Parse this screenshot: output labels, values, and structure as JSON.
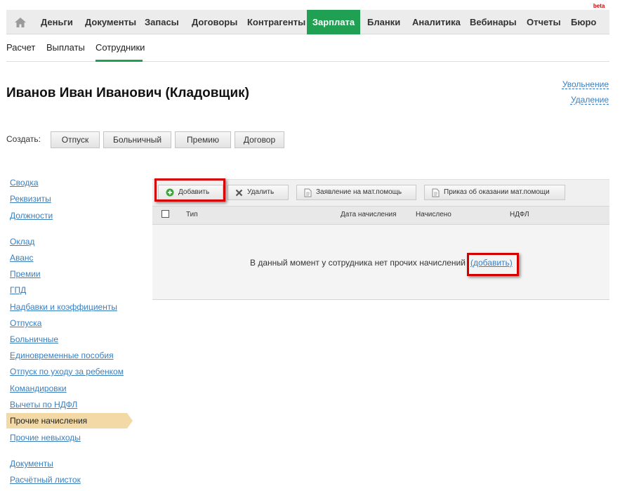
{
  "topnav": {
    "items": [
      "Деньги",
      "Документы",
      "Запасы",
      "Договоры",
      "Контрагенты",
      "Зарплата",
      "Бланки",
      "Аналитика",
      "Вебинары",
      "Отчеты",
      "Бюро"
    ],
    "beta": "beta",
    "active_color": "#20a052"
  },
  "subnav": {
    "items": [
      "Расчет",
      "Выплаты",
      "Сотрудники"
    ]
  },
  "header": {
    "title": "Иванов Иван Иванович (Кладовщик)",
    "dismiss_link": "Увольнение",
    "delete_link": "Удаление"
  },
  "create": {
    "label": "Создать:",
    "buttons": [
      "Отпуск",
      "Больничный",
      "Премию",
      "Договор"
    ]
  },
  "leftmenu": {
    "group1": [
      "Сводка",
      "Реквизиты",
      "Должности"
    ],
    "group2": [
      "Оклад",
      "Аванс",
      "Премии",
      "ГПД",
      "Надбавки и коэффициенты",
      "Отпуска",
      "Больничные",
      "Единовременные пособия",
      "Отпуск по уходу за ребенком",
      "Командировки",
      "Вычеты по НДФЛ",
      "Прочие начисления",
      "Прочие невыходы"
    ],
    "group3": [
      "Документы",
      "Расчётный листок"
    ],
    "active_color": "#f3d9a6"
  },
  "toolbar": {
    "add": "Добавить",
    "delete": "Удалить",
    "statement": "Заявление на мат.помощь",
    "order": "Приказ об оказании мат.помощи",
    "highlight_color": "#d40000"
  },
  "table": {
    "columns": [
      "Тип",
      "Дата начисления",
      "Начислено",
      "НДФЛ"
    ],
    "empty_text": "В данный момент у сотрудника нет прочих начислений",
    "empty_link": "(добавить)"
  }
}
